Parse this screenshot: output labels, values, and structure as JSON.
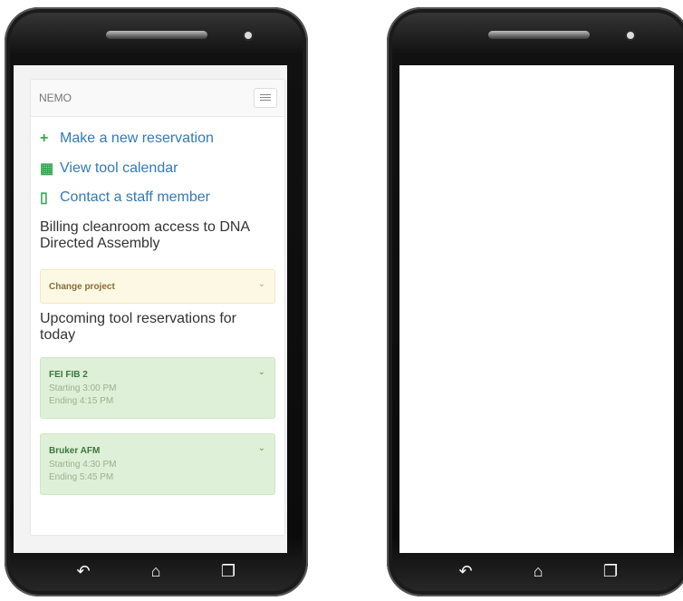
{
  "app": {
    "brand": "NEMO"
  },
  "actions": [
    {
      "icon": "plus-icon",
      "label": "Make a new reservation"
    },
    {
      "icon": "calendar-icon",
      "label": "View tool calendar"
    },
    {
      "icon": "phone-icon",
      "label": "Contact a staff member"
    }
  ],
  "billing": {
    "heading": "Billing cleanroom access to DNA Directed Assembly",
    "change_project_label": "Change project"
  },
  "upcoming": {
    "heading": "Upcoming tool reservations for today",
    "reservations": [
      {
        "tool": "FEI FIB 2",
        "start": "Starting 3:00 PM",
        "end": "Ending 4:15 PM"
      },
      {
        "tool": "Bruker AFM",
        "start": "Starting 4:30 PM",
        "end": "Ending 5:45 PM"
      }
    ]
  },
  "icons": {
    "plus": "+",
    "calendar": "▦",
    "phone": "▯",
    "chevron": "⌄",
    "back": "↶",
    "home": "⌂",
    "recent": "❐"
  },
  "colors": {
    "link": "#337ab7",
    "icon_green": "#2fa84f",
    "warning_bg": "#fcf8e3",
    "success_bg": "#dff0d8"
  }
}
